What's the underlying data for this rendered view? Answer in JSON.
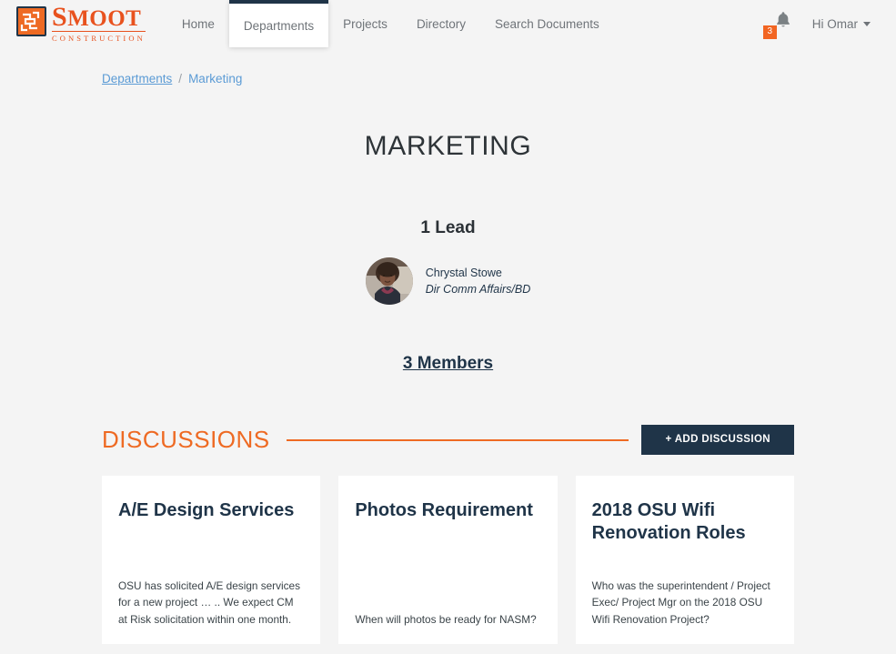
{
  "brand": {
    "name_first": "S",
    "name_rest": "MOOT",
    "subtitle": "CONSTRUCTION",
    "logo_icon": "smoot-maze-logo-icon",
    "accent_orange": "#ee6a23",
    "accent_navy": "#1f3448"
  },
  "nav": {
    "items": [
      {
        "label": "Home",
        "active": false
      },
      {
        "label": "Departments",
        "active": true
      },
      {
        "label": "Projects",
        "active": false
      },
      {
        "label": "Directory",
        "active": false
      },
      {
        "label": "Search Documents",
        "active": false
      }
    ],
    "notifications": {
      "icon": "bell-icon",
      "count": "3"
    },
    "user_menu": {
      "label": "Hi Omar",
      "icon": "chevron-down-icon"
    }
  },
  "breadcrumb": {
    "parent": "Departments",
    "separator": "/",
    "current": "Marketing"
  },
  "page": {
    "title": "MARKETING"
  },
  "leads": {
    "heading": "1 Lead",
    "people": [
      {
        "name": "Chrystal Stowe",
        "role": "Dir Comm Affairs/BD",
        "avatar": "user-photo-avatar"
      }
    ]
  },
  "members": {
    "link_label": "3 Members"
  },
  "discussions": {
    "section_title": "DISCUSSIONS",
    "add_button_label": "+ ADD DISCUSSION",
    "cards": [
      {
        "title": "A/E Design Services",
        "body": "OSU has solicited A/E design services for a new project … .. We expect CM at Risk solicitation within one month."
      },
      {
        "title": "Photos Requirement",
        "body": "When will photos be ready for NASM?"
      },
      {
        "title": "2018 OSU Wifi Renovation Roles",
        "body": "Who was the superintendent / Project Exec/ Project Mgr on the 2018 OSU Wifi Renovation Project?"
      }
    ]
  }
}
